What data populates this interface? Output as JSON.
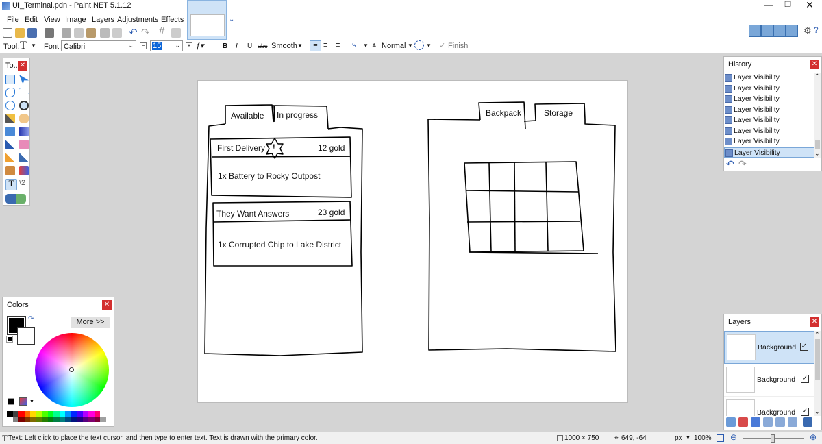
{
  "window": {
    "title": "UI_Terminal.pdn - Paint.NET 5.1.12"
  },
  "menu": {
    "items": [
      "File",
      "Edit",
      "View",
      "Image",
      "Layers",
      "Adjustments",
      "Effects"
    ]
  },
  "toolbar": {
    "tool_label": "Tool:",
    "font_label": "Font:",
    "font_value": "Calibri",
    "font_size": "15",
    "bold": "B",
    "italic": "I",
    "underline": "U",
    "strike": "abc",
    "smooth": "Smooth",
    "blend_mode": "Normal",
    "finish": "Finish"
  },
  "tools_panel": {
    "title": "To..."
  },
  "history": {
    "title": "History",
    "items": [
      "Layer Visibility",
      "Layer Visibility",
      "Layer Visibility",
      "Layer Visibility",
      "Layer Visibility",
      "Layer Visibility",
      "Layer Visibility",
      "Layer Visibility"
    ]
  },
  "colors": {
    "title": "Colors",
    "more_button": "More >>",
    "primary": "#000000",
    "secondary": "#ffffff"
  },
  "layers": {
    "title": "Layers",
    "items": [
      "Background",
      "Background",
      "Background"
    ]
  },
  "sketch": {
    "tab_available": "Available",
    "tab_in_progress": "In progress",
    "quest1_title": "First Delivery",
    "quest1_reward": "12 gold",
    "quest1_desc": "1x Battery to Rocky Outpost",
    "quest2_title": "They Want Answers",
    "quest2_reward": "23 gold",
    "quest2_desc": "1x Corrupted Chip to Lake District",
    "tab_backpack": "Backpack",
    "tab_storage": "Storage"
  },
  "status": {
    "hint": "Text: Left click to place the text cursor, and then type to enter text. Text is drawn with the primary color.",
    "image_size": "1000 × 750",
    "cursor_pos": "649, -64",
    "unit": "px",
    "zoom": "100%"
  }
}
